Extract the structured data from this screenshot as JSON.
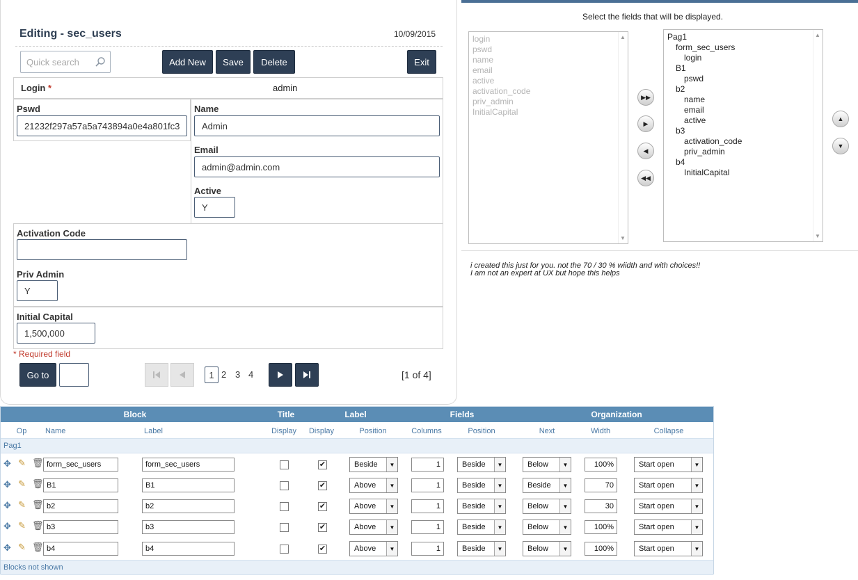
{
  "form": {
    "title": "Editing - sec_users",
    "date": "10/09/2015",
    "search_placeholder": "Quick search",
    "buttons": {
      "add_new": "Add New",
      "save": "Save",
      "delete": "Delete",
      "exit": "Exit"
    },
    "login_label": "Login",
    "required_star": "*",
    "login_value": "admin",
    "pswd_label": "Pswd",
    "pswd_value": "21232f297a57a5a743894a0e4a801fc3",
    "name_label": "Name",
    "name_value": "Admin",
    "email_label": "Email",
    "email_value": "admin@admin.com",
    "active_label": "Active",
    "active_value": "Y",
    "activation_label": "Activation Code",
    "activation_value": "",
    "priv_label": "Priv Admin",
    "priv_value": "Y",
    "capital_label": "Initial Capital",
    "capital_value": "1,500,000",
    "required_note": "* Required field",
    "goto_label": "Go to",
    "pages": [
      "1",
      "2",
      "3",
      "4"
    ],
    "current_page": "1",
    "page_status": "[1 of 4]"
  },
  "selector": {
    "caption": "Select the fields that will be displayed.",
    "available": [
      "login",
      "pswd",
      "name",
      "email",
      "active",
      "activation_code",
      "priv_admin",
      "InitialCapital"
    ],
    "selected": [
      {
        "text": "Pag1",
        "level": 0
      },
      {
        "text": "form_sec_users",
        "level": 1
      },
      {
        "text": "login",
        "level": 2
      },
      {
        "text": "B1",
        "level": 1
      },
      {
        "text": "pswd",
        "level": 2
      },
      {
        "text": "b2",
        "level": 1
      },
      {
        "text": "name",
        "level": 2
      },
      {
        "text": "email",
        "level": 2
      },
      {
        "text": "active",
        "level": 2
      },
      {
        "text": "b3",
        "level": 1
      },
      {
        "text": "activation_code",
        "level": 2
      },
      {
        "text": "priv_admin",
        "level": 2
      },
      {
        "text": "b4",
        "level": 1
      },
      {
        "text": "InitialCapital",
        "level": 2
      }
    ],
    "note_line1": "i created this just for you. not the 70 / 30 % wiidth and with choices!!",
    "note_line2": "I am not an expert at UX but hope this helps"
  },
  "table": {
    "groups": {
      "block": "Block",
      "title": "Title",
      "label": "Label",
      "fields": "Fields",
      "organization": "Organization"
    },
    "columns": {
      "op": "Op",
      "name": "Name",
      "label": "Label",
      "title_display": "Display",
      "label_display": "Display",
      "label_position": "Position",
      "columns": "Columns",
      "fields_position": "Position",
      "next": "Next",
      "width": "Width",
      "collapse": "Collapse"
    },
    "page_group": "Pag1",
    "footer": "Blocks not shown",
    "rows": [
      {
        "name": "form_sec_users",
        "label": "form_sec_users",
        "title_display": false,
        "label_display": true,
        "label_position": "Beside",
        "columns": "1",
        "fields_position": "Beside",
        "next": "Below",
        "width": "100%",
        "collapse": "Start open"
      },
      {
        "name": "B1",
        "label": "B1",
        "title_display": false,
        "label_display": true,
        "label_position": "Above",
        "columns": "1",
        "fields_position": "Beside",
        "next": "Beside",
        "width": "70",
        "collapse": "Start open"
      },
      {
        "name": "b2",
        "label": "b2",
        "title_display": false,
        "label_display": true,
        "label_position": "Above",
        "columns": "1",
        "fields_position": "Beside",
        "next": "Below",
        "width": "30",
        "collapse": "Start open"
      },
      {
        "name": "b3",
        "label": "b3",
        "title_display": false,
        "label_display": true,
        "label_position": "Above",
        "columns": "1",
        "fields_position": "Beside",
        "next": "Below",
        "width": "100%",
        "collapse": "Start open"
      },
      {
        "name": "b4",
        "label": "b4",
        "title_display": false,
        "label_display": true,
        "label_position": "Above",
        "columns": "1",
        "fields_position": "Beside",
        "next": "Below",
        "width": "100%",
        "collapse": "Start open"
      }
    ]
  }
}
